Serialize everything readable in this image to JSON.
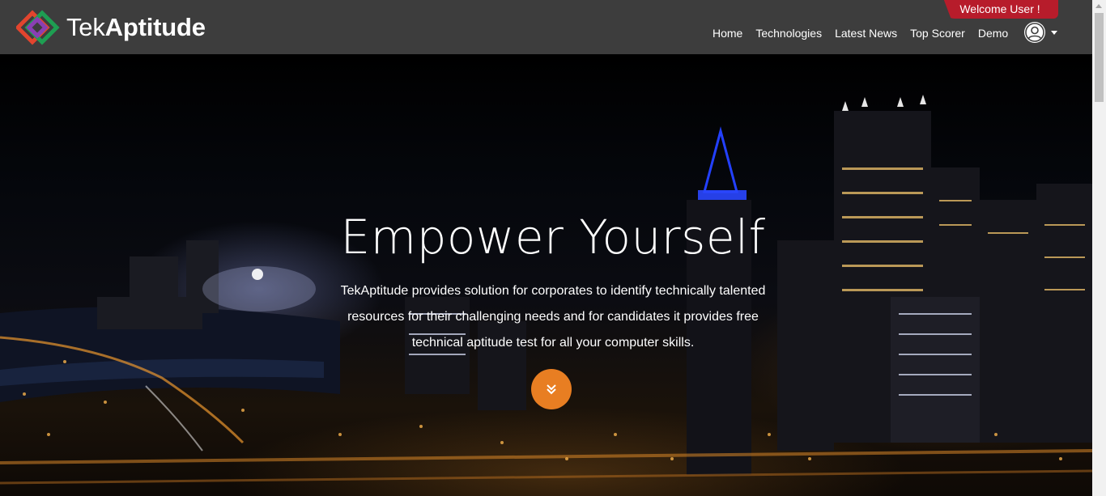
{
  "brand": {
    "prefix": "Tek",
    "suffix": "Aptitude",
    "logo_icon": "diamond-logo-icon"
  },
  "welcome": "Welcome User !",
  "nav": {
    "items": [
      {
        "label": "Home"
      },
      {
        "label": "Technologies"
      },
      {
        "label": "Latest News"
      },
      {
        "label": "Top Scorer"
      },
      {
        "label": "Demo"
      }
    ],
    "user_icon": "user-circle-icon"
  },
  "hero": {
    "title": "Empower Yourself",
    "description": "TekAptitude provides solution for corporates to identify technically talented resources for their challenging needs and for candidates it provides free technical aptitude test for all your computer skills.",
    "scroll_icon": "double-chevron-down-icon",
    "background": "night city skyline photo"
  },
  "colors": {
    "header": "#3d3d3d",
    "welcome_badge": "#b71c2b",
    "accent_orange": "#e87e22"
  }
}
